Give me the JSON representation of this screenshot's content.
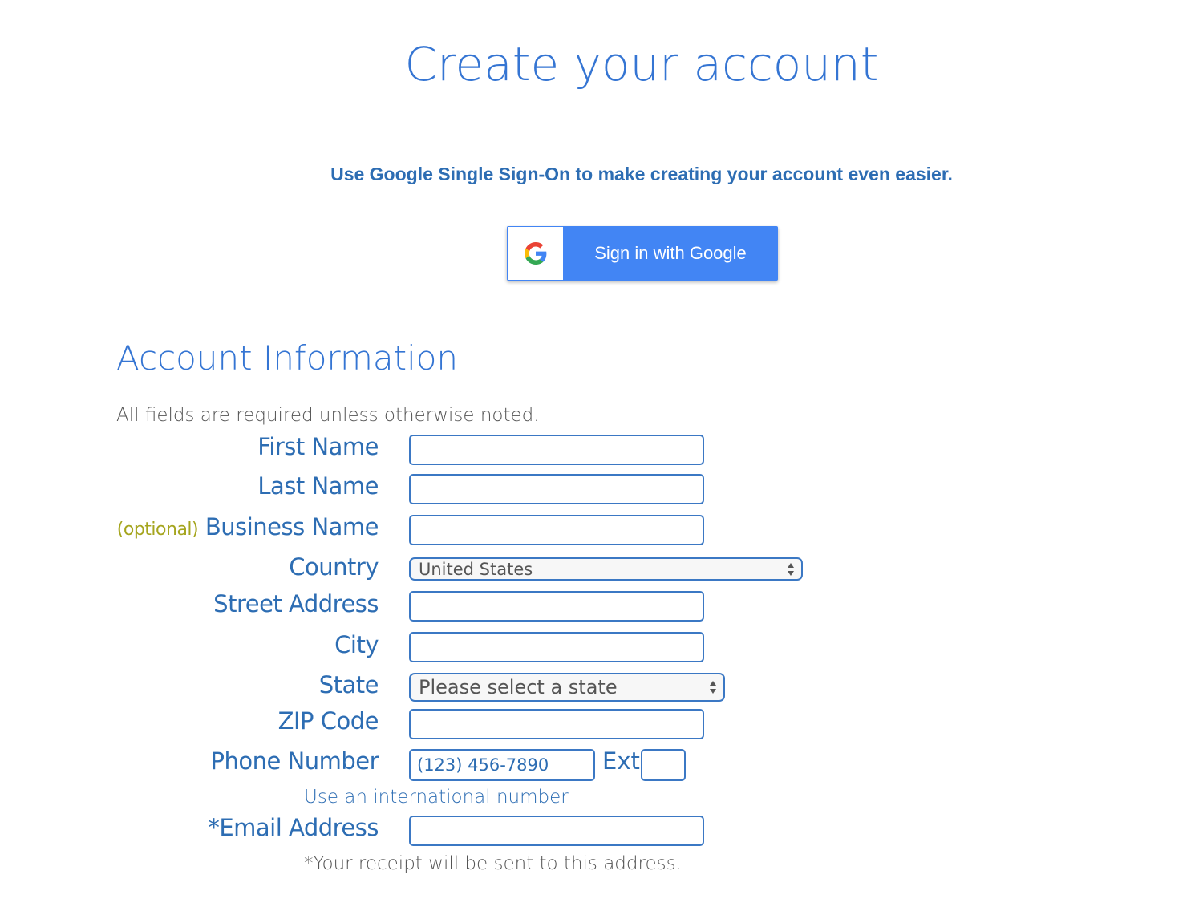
{
  "page": {
    "title": "Create your account",
    "sso_prompt": "Use Google Single Sign-On to make creating your account even easier.",
    "google_button": {
      "label": "Sign in with Google",
      "icon": "google-g-icon",
      "bg_color": "#4285f4"
    }
  },
  "account": {
    "section_title": "Account Information",
    "note": "All fields are required unless otherwise noted.",
    "fields": {
      "first_name": {
        "label": "First Name",
        "value": ""
      },
      "last_name": {
        "label": "Last Name",
        "value": ""
      },
      "business_name": {
        "optional_tag": "(optional)",
        "label": "Business Name",
        "value": ""
      },
      "country": {
        "label": "Country",
        "selected": "United States"
      },
      "street_address": {
        "label": "Street Address",
        "value": ""
      },
      "city": {
        "label": "City",
        "value": ""
      },
      "state": {
        "label": "State",
        "selected": "Please select a state"
      },
      "zip": {
        "label": "ZIP Code",
        "value": ""
      },
      "phone": {
        "label": "Phone Number",
        "placeholder": "(123) 456-7890",
        "ext_label": "Ext",
        "ext_value": ""
      },
      "intl_link": "Use an international number",
      "email": {
        "label": "*Email Address",
        "value": "",
        "note": "*Your receipt will be sent to this address."
      }
    }
  },
  "colors": {
    "heading": "#3575d3",
    "label": "#2d6db3",
    "optional": "#a5a51e",
    "border": "#3b78c4"
  }
}
